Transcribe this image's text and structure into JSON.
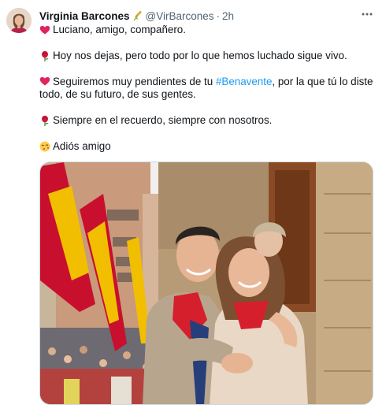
{
  "author": {
    "name": "Virginia Barcones",
    "handle": "@VirBarcones",
    "separator": "·",
    "time": "2h",
    "badge_icon": "wheat-icon"
  },
  "tweet": {
    "lines": [
      {
        "emoji": "red-heart-emoji",
        "text": "Luciano, amigo, compañero."
      },
      {
        "emoji": "rose-emoji",
        "text": "Hoy nos dejas, pero todo por lo que hemos luchado sigue vivo."
      },
      {
        "emoji": "red-heart-emoji",
        "text_before": "Seguiremos muy pendientes de tu ",
        "hashtag": "#Benavente",
        "text_after": ", por la que tú lo diste todo, de su futuro, de sus gentes."
      },
      {
        "emoji": "rose-emoji",
        "text": "Siempre en el recuerdo, siempre con nosotros."
      },
      {
        "emoji": "face-blowing-kiss-emoji",
        "text": "Adiós amigo"
      }
    ]
  },
  "media": {
    "kind": "photo",
    "icon": "photo-icon"
  },
  "colors": {
    "link": "#1d9bf0",
    "secondary_text": "#536471",
    "primary_text": "#0f1419",
    "border": "#cfd9de"
  }
}
